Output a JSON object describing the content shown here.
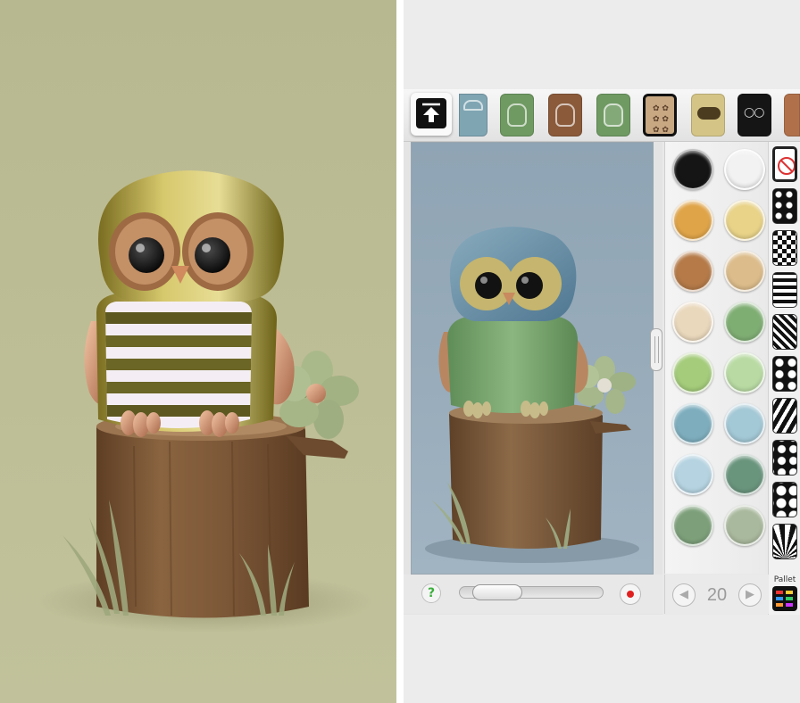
{
  "left_panel": {
    "background": "#bcbc94",
    "owl_body_color": "#c9b85a",
    "belly_stripes": [
      "#5f5a1c",
      "#f4eef4"
    ],
    "flower_color": "#a8b888",
    "stump_color": "#7a5636"
  },
  "right_panel": {
    "toolbar": {
      "upload_icon": "upload-arrow-icon",
      "tiles": [
        {
          "name": "head-shape-1",
          "color": "#7fa5b3"
        },
        {
          "name": "body-shape-1",
          "color": "#6f9a62"
        },
        {
          "name": "body-shape-2",
          "color": "#8a5a3a"
        },
        {
          "name": "body-shape-3",
          "color": "#6f9a62"
        },
        {
          "name": "pattern-tile",
          "color": "#c7a883"
        },
        {
          "name": "eyes-tile",
          "color": "#d4c486"
        },
        {
          "name": "eyes-dark-tile",
          "color": "#151515"
        },
        {
          "name": "extra-tile",
          "color": "#b0714a"
        }
      ],
      "selected_tile": "pattern-tile"
    },
    "viewport": {
      "background": "#97abba",
      "owl_head_color": "#6f94ab",
      "owl_body_color": "#7faa73",
      "owl_face_color": "#c8b976"
    },
    "bottom_bar": {
      "help_label": "?",
      "record_icon": "record-icon"
    },
    "palette": {
      "swatches": [
        [
          "#151515",
          "#f2f2f2"
        ],
        [
          "#e0a448",
          "#e9d388"
        ],
        [
          "#b57a48",
          "#dcbc8a"
        ],
        [
          "#ead8bc",
          "#7fae73"
        ],
        [
          "#a4cc7a",
          "#b9dba3"
        ],
        [
          "#7eaebe",
          "#a3c8d6"
        ],
        [
          "#b5d3e1",
          "#6a957d"
        ],
        [
          "#7da07a",
          "#a9b99d"
        ]
      ],
      "patterns": [
        "none-pattern",
        "dots-pattern",
        "checker-pattern",
        "stripes-pattern",
        "zigzag-pattern",
        "stars-pattern",
        "zebra-pattern",
        "hearts-pattern",
        "flowers-pattern",
        "rays-pattern"
      ],
      "pallet_label": "Pallet",
      "page_number": "20",
      "prev_icon": "arrow-left-icon",
      "next_icon": "arrow-right-icon"
    }
  }
}
